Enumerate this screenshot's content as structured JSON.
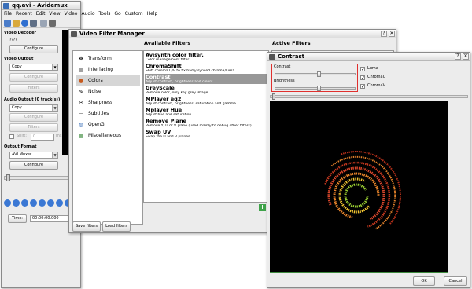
{
  "main_window": {
    "title": "qq.avi - Avidemux",
    "menu": [
      "File",
      "Recent",
      "Edit",
      "View",
      "Video",
      "Audio",
      "Tools",
      "Go",
      "Custom",
      "Help"
    ],
    "video_decoder": {
      "heading": "Video Decoder",
      "value": "????",
      "configure": "Configure"
    },
    "video_output": {
      "heading": "Video Output",
      "selected": "Copy",
      "configure": "Configure",
      "filters": "Filters"
    },
    "audio_output": {
      "heading": "Audio Output (0 track(s))",
      "selected": "Copy",
      "configure": "Configure",
      "filters": "Filters",
      "shift_label": "Shift:",
      "shift_value": "0",
      "shift_unit": "ms"
    },
    "output_format": {
      "heading": "Output Format",
      "selected": "AVI Muxer",
      "configure": "Configure"
    },
    "time_button": "Time:",
    "time_value": "00:00:00.000"
  },
  "filter_manager": {
    "title": "Video Filter Manager",
    "categories": [
      {
        "label": "Transform",
        "icon": "transform-icon",
        "glyph": "✥"
      },
      {
        "label": "Interlacing",
        "icon": "interlacing-icon",
        "glyph": "▤"
      },
      {
        "label": "Colors",
        "icon": "colors-icon",
        "glyph": "●"
      },
      {
        "label": "Noise",
        "icon": "noise-icon",
        "glyph": "✎"
      },
      {
        "label": "Sharpness",
        "icon": "sharpness-icon",
        "glyph": "✂"
      },
      {
        "label": "Subtitles",
        "icon": "subtitles-icon",
        "glyph": "▭"
      },
      {
        "label": "OpenGl",
        "icon": "opengl-icon",
        "glyph": "◍"
      },
      {
        "label": "Miscellaneous",
        "icon": "misc-icon",
        "glyph": "▦"
      }
    ],
    "available_heading": "Available Filters",
    "filters": [
      {
        "name": "Avisynth color filter.",
        "desc": "Color management filter."
      },
      {
        "name": "ChromaShift",
        "desc": "Shift chroma U/V to fix badly synced chroma/luma."
      },
      {
        "name": "Contrast",
        "desc": "Adjust contrast, brightness and colors."
      },
      {
        "name": "GreyScale",
        "desc": "Remove color, only key grey image."
      },
      {
        "name": "MPlayer eq2",
        "desc": "Adjust contrast, brightness, saturation and gamma."
      },
      {
        "name": "Mplayer Hue",
        "desc": "Adjust hue and saturation."
      },
      {
        "name": "Remove Plane",
        "desc": "Remove Y, U or V plane (used mainly to debug other filters)."
      },
      {
        "name": "Swap UV",
        "desc": "Swap the U and V planes."
      }
    ],
    "active_heading": "Active Filters",
    "save_filters": "Save filters",
    "load_filters": "Load filters"
  },
  "contrast_dialog": {
    "title": "Contrast",
    "contrast_label": "Contrast",
    "brightness_label": "Brightness",
    "contrast_level": 0.55,
    "brightness_level": 0.55,
    "checks": [
      {
        "label": "Luma",
        "checked": true
      },
      {
        "label": "ChromaU",
        "checked": true
      },
      {
        "label": "ChromaV",
        "checked": true
      }
    ],
    "ok": "OK",
    "cancel": "Cancel"
  },
  "colors": {
    "highlight_border": "#e0302e",
    "active_filter_bg": "#989898",
    "preview_bg": "#000000"
  }
}
